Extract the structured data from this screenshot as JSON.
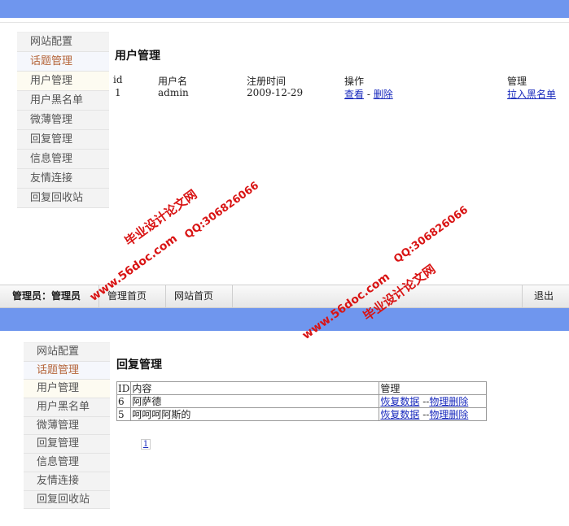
{
  "sidebar": {
    "items": [
      "网站配置",
      "话题管理",
      "用户管理",
      "用户黑名单",
      "微薄管理",
      "回复管理",
      "信息管理",
      "友情连接",
      "回复回收站"
    ]
  },
  "user_panel": {
    "title": "用户管理",
    "headers": [
      "id",
      "用户名",
      "注册时间",
      "操作",
      "管理"
    ],
    "rows": [
      {
        "id": "1",
        "username": "admin",
        "registered": "2009-12-29",
        "view": "查看",
        "sep": " - ",
        "delete": "删除",
        "manage": "拉入黑名单"
      }
    ]
  },
  "nav": {
    "admin_label": "管理员：管理员",
    "home_label": "管理首页",
    "site_home_label": "网站首页",
    "logout_label": "退出"
  },
  "reply_panel": {
    "title": "回复管理",
    "headers": [
      "ID",
      "内容",
      "管理"
    ],
    "rows": [
      {
        "id": "6",
        "content": "阿萨德",
        "restore": "恢复数据",
        "sep": " --",
        "purge": "物理删除"
      },
      {
        "id": "5",
        "content": "呵呵呵阿斯的",
        "restore": "恢复数据",
        "sep": " --",
        "purge": "物理删除"
      }
    ],
    "pager": "1"
  },
  "watermarks": {
    "brand": "毕业设计论文网",
    "url": "www.56doc.com",
    "qq": "QQ:306826066"
  },
  "colors": {
    "header_blue": "#6f96ee",
    "active_item": "#b5653a",
    "link": "#1a2bbd",
    "watermark": "#d91414"
  }
}
